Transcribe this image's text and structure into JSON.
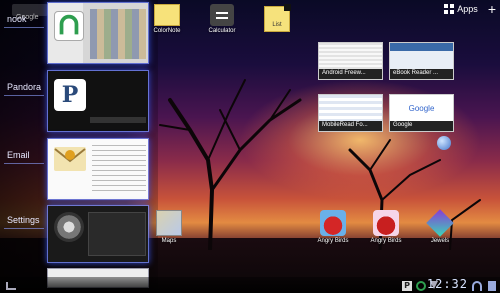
{
  "top_bar": {
    "search_placeholder": "Google",
    "apps_label": "Apps",
    "add_label": "+"
  },
  "recent_apps": [
    {
      "label": "nook"
    },
    {
      "label": "Pandora"
    },
    {
      "label": "Email"
    },
    {
      "label": "Settings"
    }
  ],
  "home_icons": {
    "colornote": {
      "label": "ColorNote"
    },
    "calculator": {
      "label": "Calculator"
    },
    "list": {
      "label": "List"
    },
    "maps": {
      "label": "Maps"
    },
    "angry_birds_1": {
      "label": "Angry Birds"
    },
    "angry_birds_2": {
      "label": "Angry Birds"
    },
    "jewels": {
      "label": "Jewels"
    }
  },
  "browser_widgets": [
    {
      "title": "Android Freew..."
    },
    {
      "title": "eBook Reader ..."
    },
    {
      "title": "MobileRead Fo..."
    },
    {
      "title": "Google"
    }
  ],
  "status_bar": {
    "clock": "12:32",
    "p_icon": "P"
  },
  "colors": {
    "accent": "#5c7cff",
    "nook_green": "#2e9e4f",
    "pandora_blue": "#2a4a7a"
  }
}
